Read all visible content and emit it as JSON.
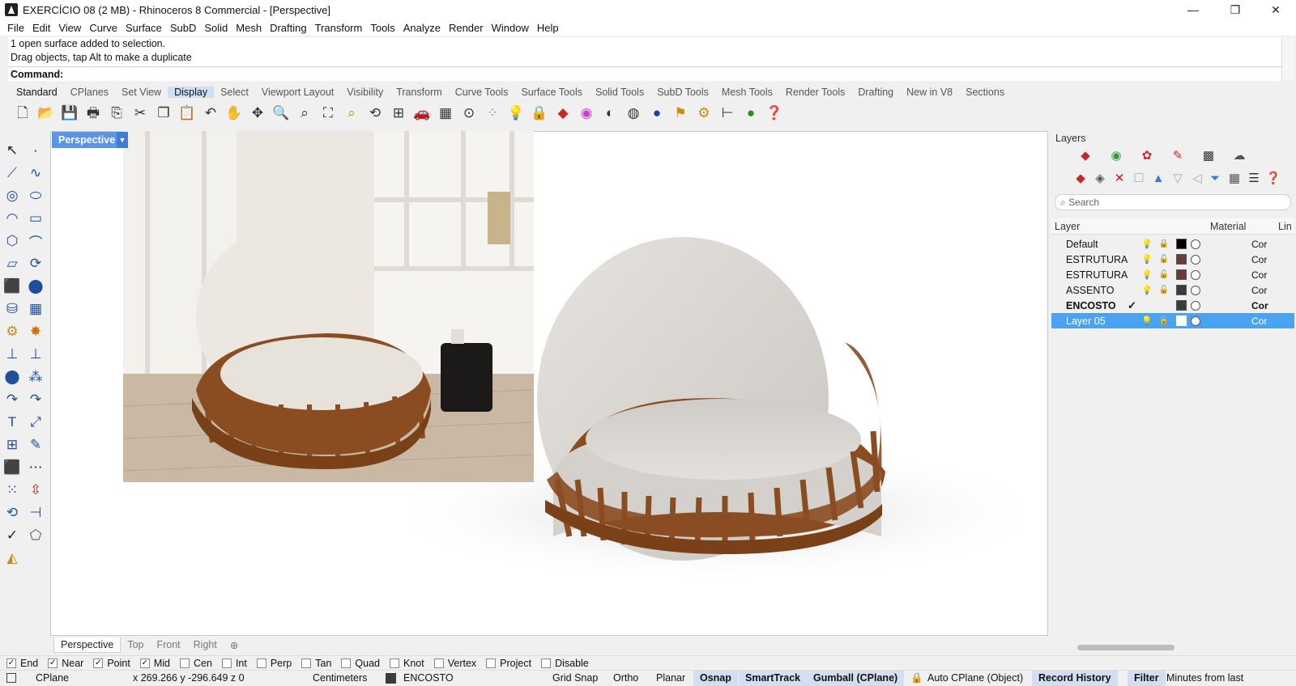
{
  "window": {
    "title": "EXERCÍCIO 08 (2 MB) - Rhinoceros 8 Commercial - [Perspective]",
    "minimize": "—",
    "restore": "❐",
    "close": "✕"
  },
  "menu": [
    "File",
    "Edit",
    "View",
    "Curve",
    "Surface",
    "SubD",
    "Solid",
    "Mesh",
    "Drafting",
    "Transform",
    "Tools",
    "Analyze",
    "Render",
    "Window",
    "Help"
  ],
  "command_history": {
    "line1": "1 open surface added to selection.",
    "line2": "Drag objects, tap Alt to make a duplicate"
  },
  "command_prompt": "Command:",
  "toolbar_tabs": [
    "Standard",
    "CPlanes",
    "Set View",
    "Display",
    "Select",
    "Viewport Layout",
    "Visibility",
    "Transform",
    "Curve Tools",
    "Surface Tools",
    "Solid Tools",
    "SubD Tools",
    "Mesh Tools",
    "Render Tools",
    "Drafting",
    "New in V8",
    "Sections"
  ],
  "active_tab": "Standard",
  "toolbar_icons": [
    "new-icon",
    "open-icon",
    "save-icon",
    "print-icon",
    "import-icon",
    "cut-icon",
    "copy-icon",
    "paste-icon",
    "undo-icon",
    "pan-icon",
    "rotate-view-icon",
    "zoom-icon",
    "zoom-window-icon",
    "zoom-extents-icon",
    "zoom-selected-icon",
    "undo-view-icon",
    "four-viewports-icon",
    "car-icon",
    "grid-icon",
    "osnap-icon",
    "points-icon",
    "light-icon",
    "lock-icon",
    "layer-icon",
    "color-icon",
    "shaded-icon",
    "wireframe-icon",
    "rendered-icon",
    "filter-icon",
    "settings-icon",
    "dimension-icon",
    "render-icon",
    "help-icon"
  ],
  "viewport": {
    "label": "Perspective",
    "tabs": [
      "Perspective",
      "Top",
      "Front",
      "Right"
    ],
    "add_tab": "⊕"
  },
  "layers": {
    "title": "Layers",
    "search_placeholder": "Search",
    "columns": {
      "layer": "Layer",
      "material": "Material",
      "linetype": "Lin"
    },
    "rows": [
      {
        "name": "Default",
        "color": "#000000",
        "current": false,
        "linetype": "Cor"
      },
      {
        "name": "ESTRUTURA",
        "color": "#6b3a3a",
        "current": false,
        "linetype": "Cor"
      },
      {
        "name": "ESTRUTURA",
        "color": "#6b3a3a",
        "current": false,
        "linetype": "Cor"
      },
      {
        "name": "ASSENTO",
        "color": "#3b3b3b",
        "current": false,
        "linetype": "Cor"
      },
      {
        "name": "ENCOSTO",
        "color": "#3b3b3b",
        "current": true,
        "check": "✓",
        "linetype": "Cor"
      },
      {
        "name": "Layer 05",
        "color": "#ffffff",
        "current": false,
        "linetype": "Cor"
      }
    ]
  },
  "osnaps": [
    {
      "label": "End",
      "checked": true
    },
    {
      "label": "Near",
      "checked": true
    },
    {
      "label": "Point",
      "checked": true
    },
    {
      "label": "Mid",
      "checked": true
    },
    {
      "label": "Cen",
      "checked": false
    },
    {
      "label": "Int",
      "checked": false
    },
    {
      "label": "Perp",
      "checked": false
    },
    {
      "label": "Tan",
      "checked": false
    },
    {
      "label": "Quad",
      "checked": false
    },
    {
      "label": "Knot",
      "checked": false
    },
    {
      "label": "Vertex",
      "checked": false
    },
    {
      "label": "Project",
      "checked": false
    },
    {
      "label": "Disable",
      "checked": false
    }
  ],
  "status": {
    "cplane": "CPlane",
    "coords": "x 269.266   y -296.649   z 0",
    "units": "Centimeters",
    "layer": "ENCOSTO",
    "grid_snap": "Grid Snap",
    "ortho": "Ortho",
    "planar": "Planar",
    "osnap": "Osnap",
    "smarttrack": "SmartTrack",
    "gumball": "Gumball (CPlane)",
    "auto_cplane": "Auto CPlane (Object)",
    "record_history": "Record History",
    "filter": "Filter",
    "minutes": "Minutes from last"
  },
  "colors": {
    "accent": "#5b95e8",
    "selection": "#4aa3f0",
    "wood": "#8a4d22",
    "fabric": "#d9d6d0"
  }
}
